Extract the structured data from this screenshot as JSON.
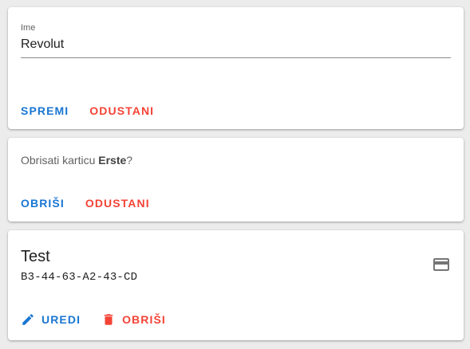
{
  "edit_form": {
    "name_label": "Ime",
    "name_value": "Revolut",
    "save_label": "SPREMI",
    "cancel_label": "ODUSTANI"
  },
  "delete_confirm": {
    "prompt_prefix": "Obrisati karticu ",
    "card_name": "Erste",
    "prompt_suffix": "?",
    "delete_label": "OBRIŠI",
    "cancel_label": "ODUSTANI"
  },
  "card_item": {
    "title": "Test",
    "number": "B3-44-63-A2-43-CD",
    "card_icon": "credit-card-icon",
    "edit_icon": "pencil-icon",
    "edit_label": "UREDI",
    "delete_icon": "trash-icon",
    "delete_label": "OBRIŠI"
  },
  "colors": {
    "primary": "#1976d2",
    "danger": "#f44336",
    "background": "#ececec",
    "card": "#ffffff"
  }
}
